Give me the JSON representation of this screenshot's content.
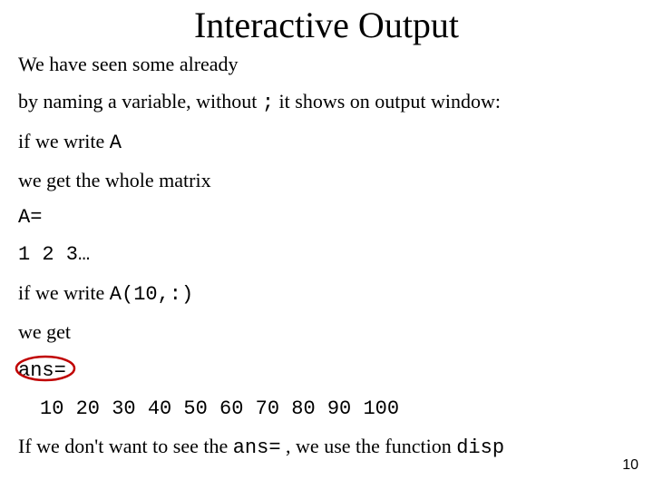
{
  "title": "Interactive Output",
  "lines": {
    "l1": "We have seen some already",
    "l2_pre": "by naming a variable, without ",
    "l2_semi": ";",
    "l2_post": "  it shows on output window:",
    "l3_pre": "if we write ",
    "l3_code": "A",
    "l4": "we get the whole matrix",
    "l5": "A=",
    "l6": "1 2 3…",
    "l7_pre": "if we write ",
    "l7_code": "A(10,:)",
    "l8": "we get",
    "l9": "ans=",
    "l10": "10 20 30 40 50 60 70 80 90 100",
    "l11_pre": "If we don't want to see the ",
    "l11_code1": "ans=",
    "l11_mid": " , we use the function ",
    "l11_code2": "disp"
  },
  "page_number": "10"
}
